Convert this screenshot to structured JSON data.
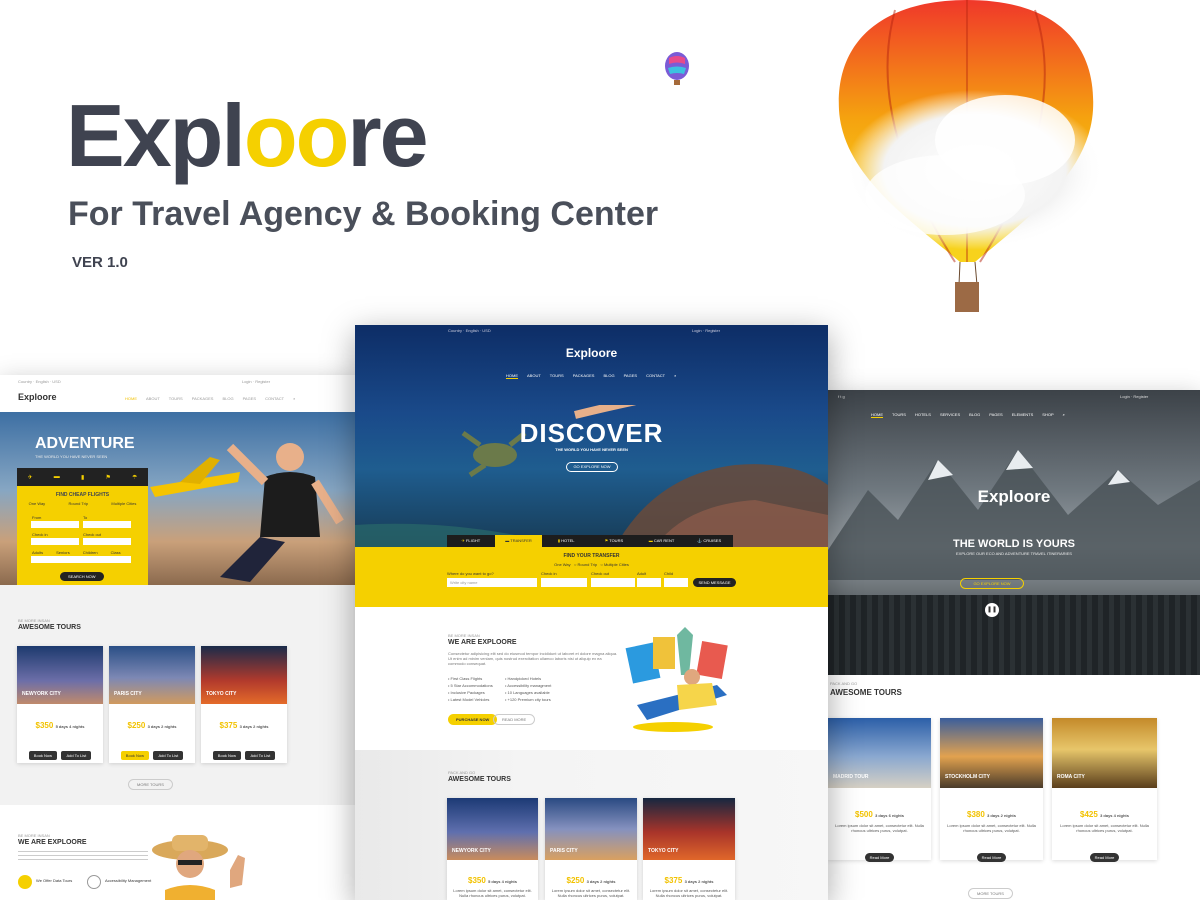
{
  "hero": {
    "logo_part1": "Expl",
    "logo_part2": "oo",
    "logo_part3": "re",
    "tagline": "For Travel Agency & Booking Center",
    "version": "VER 1.0"
  },
  "colors": {
    "accent": "#f5d000",
    "dark": "#3f4350"
  },
  "left_mock": {
    "topbar": [
      "Country",
      "English",
      "USD",
      "Login",
      "Register"
    ],
    "logo": "Exploore",
    "nav": [
      "HOME",
      "ABOUT",
      "TOURS",
      "PACKAGES",
      "BLOG",
      "PAGES",
      "CONTACT"
    ],
    "hero_title": "ADVENTURE",
    "hero_sub": "THE WORLD YOU HAVE NEVER SEEN",
    "form_title": "FIND CHEAP FLIGHTS",
    "form_options": [
      "One Way",
      "Round Trip",
      "Multiple Cities"
    ],
    "form_labels": [
      "From",
      "To",
      "Check in",
      "Check out",
      "Adults",
      "Seniors",
      "Children",
      "Class"
    ],
    "form_button": "SEARCH NOW",
    "section_kicker": "BE MORE INSAN",
    "section_title": "AWESOME TOURS",
    "tours": [
      {
        "name": "NEWYORK CITY",
        "price": "350",
        "days": "5 days 4 nights"
      },
      {
        "name": "PARIS CITY",
        "price": "250",
        "days": "3 days 2 nights"
      },
      {
        "name": "TOKYO CITY",
        "price": "375",
        "days": "3 days 2 nights"
      }
    ],
    "book_label": "Book Now",
    "add_label": "Add To List",
    "more_label": "MORE TOURS",
    "about_kicker": "BE MORE INSAN",
    "about_title": "WE ARE EXPLOORE",
    "features": [
      "We Offer Data Tours",
      "Accessibility Management"
    ]
  },
  "center_mock": {
    "topbar": [
      "Country",
      "English",
      "USD",
      "Login",
      "Register"
    ],
    "logo": "Exploore",
    "nav": [
      "HOME",
      "ABOUT",
      "TOURS",
      "PACKAGES",
      "BLOG",
      "PAGES",
      "CONTACT"
    ],
    "hero_title": "DISCOVER",
    "hero_sub": "THE WORLD YOU HAVE NEVER SEEN",
    "hero_button": "GO EXPLORE NOW",
    "tabs": [
      "FLIGHT",
      "TRANSFER",
      "HOTEL",
      "TOURS",
      "CAR RENT",
      "CRUISES"
    ],
    "form_title": "FIND YOUR TRANSFER",
    "form_options": [
      "One Way",
      "Round Trip",
      "Multiple Cities"
    ],
    "form_labels": [
      "Where do you want to go?",
      "Check in",
      "Check out",
      "Adult",
      "Child"
    ],
    "form_placeholder": "Write city name",
    "form_button": "SEND MESSAGE",
    "about_kicker": "BE MORE INSAN",
    "about_title": "WE ARE EXPLOORE",
    "about_text": "Consectetur adipisicing elit sed do eiusmod tempor incididunt ut laboret et dolore magna aliqua. Ut enim ad minim veniam, quis nostrud exercitation ullamco laboris nisi ut aliquip ex ea commodo consequat.",
    "features_left": [
      "First Class Flights",
      "5 Star Accommodations",
      "Inclusive Packages",
      "Latest Model Vehicles"
    ],
    "features_right": [
      "Handpicked Hotels",
      "Accessibility managment",
      "10 Languages available",
      "+120 Premium city tours"
    ],
    "purchase_button": "PURCHASE NOW",
    "read_more": "READ MORE",
    "section_kicker": "PACK AND GO",
    "section_title": "AWESOME TOURS",
    "tours": [
      {
        "name": "NEWYORK CITY",
        "price": "350",
        "days": "5 days 4 nights",
        "desc": "Lorem ipsum dolor sit amet, consectetur elit. Nulla rhoncus ultrices purus, volutpat."
      },
      {
        "name": "PARIS CITY",
        "price": "250",
        "days": "3 days 2 nights",
        "desc": "Lorem ipsum dolor sit amet, consectetur elit. Nulla rhoncus ultrices purus, volutpat."
      },
      {
        "name": "TOKYO CITY",
        "price": "375",
        "days": "3 days 2 nights",
        "desc": "Lorem ipsum dolor sit amet, consectetur elit. Nulla rhoncus ultrices purus, volutpat."
      }
    ]
  },
  "right_mock": {
    "topbar": [
      "Login",
      "Register"
    ],
    "nav": [
      "HOME",
      "TOURS",
      "HOTELS",
      "SERVICES",
      "BLOG",
      "PAGES",
      "ELEMENTS",
      "SHOP"
    ],
    "logo": "Exploore",
    "hero_title": "THE WORLD IS YOURS",
    "hero_sub": "EXPLORE OUR ECO AND ADVENTURE TRAVEL ITINERARIES",
    "hero_button": "GO EXPLORE NOW",
    "section_kicker": "PACK AND GO",
    "section_title": "AWESOME TOURS",
    "tours": [
      {
        "name": "MADRID TOUR",
        "price": "500",
        "days": "3 days 6 nights",
        "desc": "Lorem ipsum dolor sit amet, consectetur elit. Nulla rhoncus ultrices purus, volutpat."
      },
      {
        "name": "STOCKHOLM CITY",
        "price": "380",
        "days": "3 days 2 nights",
        "desc": "Lorem ipsum dolor sit amet, consectetur elit. Nulla rhoncus ultrices purus, volutpat."
      },
      {
        "name": "ROMA CITY",
        "price": "425",
        "days": "3 days 4 nights",
        "desc": "Lorem ipsum dolor sit amet, consectetur elit. Nulla rhoncus ultrices purus, volutpat."
      }
    ],
    "read_more": "Read More",
    "more_label": "MORE TOURS"
  }
}
